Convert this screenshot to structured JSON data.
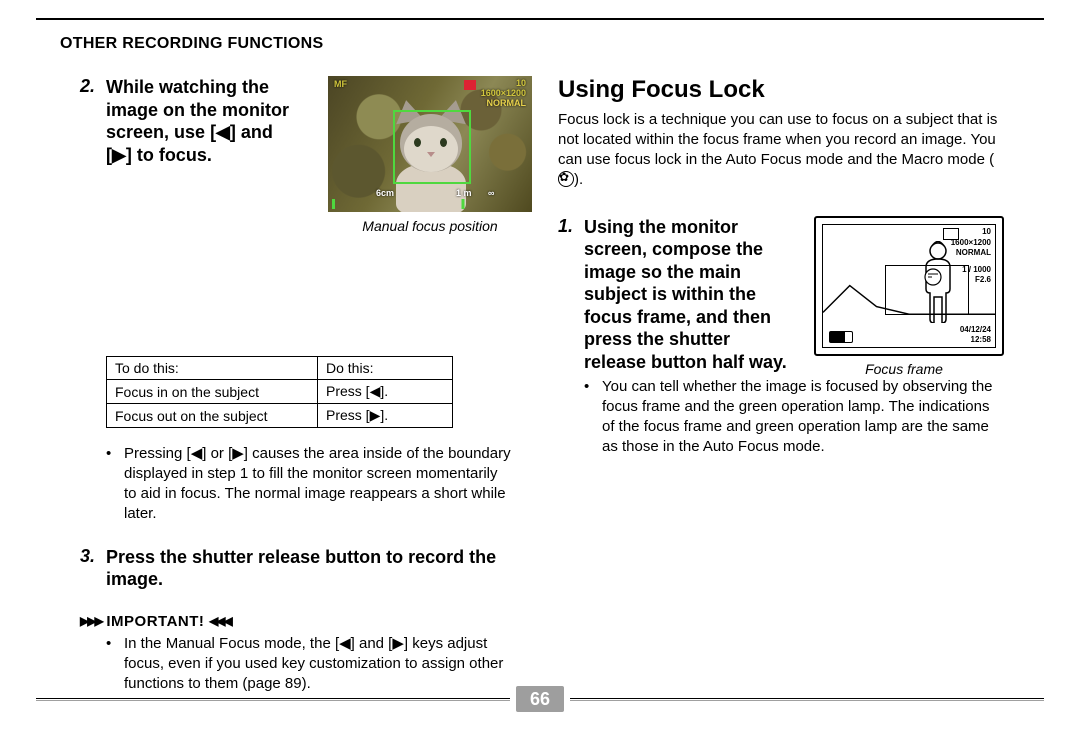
{
  "header": {
    "title": "OTHER RECORDING FUNCTIONS"
  },
  "left": {
    "step2": {
      "num": "2.",
      "text": "While watching the image on the monitor screen, use [◀] and [▶] to focus."
    },
    "figure_caption": "Manual focus position",
    "camera_osd": {
      "mf": "MF",
      "rec_size": "1600×1200",
      "normal": "NORMAL",
      "count": "10",
      "scale_a": "6cm",
      "scale_b": "1 m",
      "scale_c": "∞"
    },
    "table": {
      "h1": "To do this:",
      "h2": "Do this:",
      "r1c1": "Focus in on the subject",
      "r1c2": "Press [◀].",
      "r2c1": "Focus out on the subject",
      "r2c2": "Press [▶]."
    },
    "bullet1": "Pressing [◀] or [▶] causes the area inside of the boundary displayed in step 1 to fill the monitor screen momentarily to aid in focus. The normal image reappears a short while later.",
    "step3": {
      "num": "3.",
      "text": "Press the shutter release button to record the image."
    },
    "important": {
      "title": "IMPORTANT!",
      "bullet": "In the Manual Focus mode, the [◀] and [▶] keys adjust focus, even if you used key customization to assign other functions to them (page 89)."
    }
  },
  "right": {
    "heading": "Using Focus Lock",
    "para1": "Focus lock is a technique you can use to focus on a subject that is not located within the focus frame when you record an image. You can use focus lock in the Auto Focus mode and the Macro mode (",
    "para1_tail": ").",
    "step1": {
      "num": "1.",
      "text": "Using the monitor screen, compose the image so the main subject is within the focus frame, and then press the shutter release button half way."
    },
    "ff_caption": "Focus frame",
    "ff_osd": {
      "count": "10",
      "size": "1600×1200",
      "normal": "NORMAL",
      "shutter": "1 / 1000",
      "f": "F2.6",
      "date": "04/12/24",
      "time": "12:58"
    },
    "bullet": "You can tell whether the image is focused by observing the focus frame and the green operation lamp. The indications of the focus frame and green operation lamp are the same as those in the Auto Focus mode."
  },
  "page_number": "66"
}
